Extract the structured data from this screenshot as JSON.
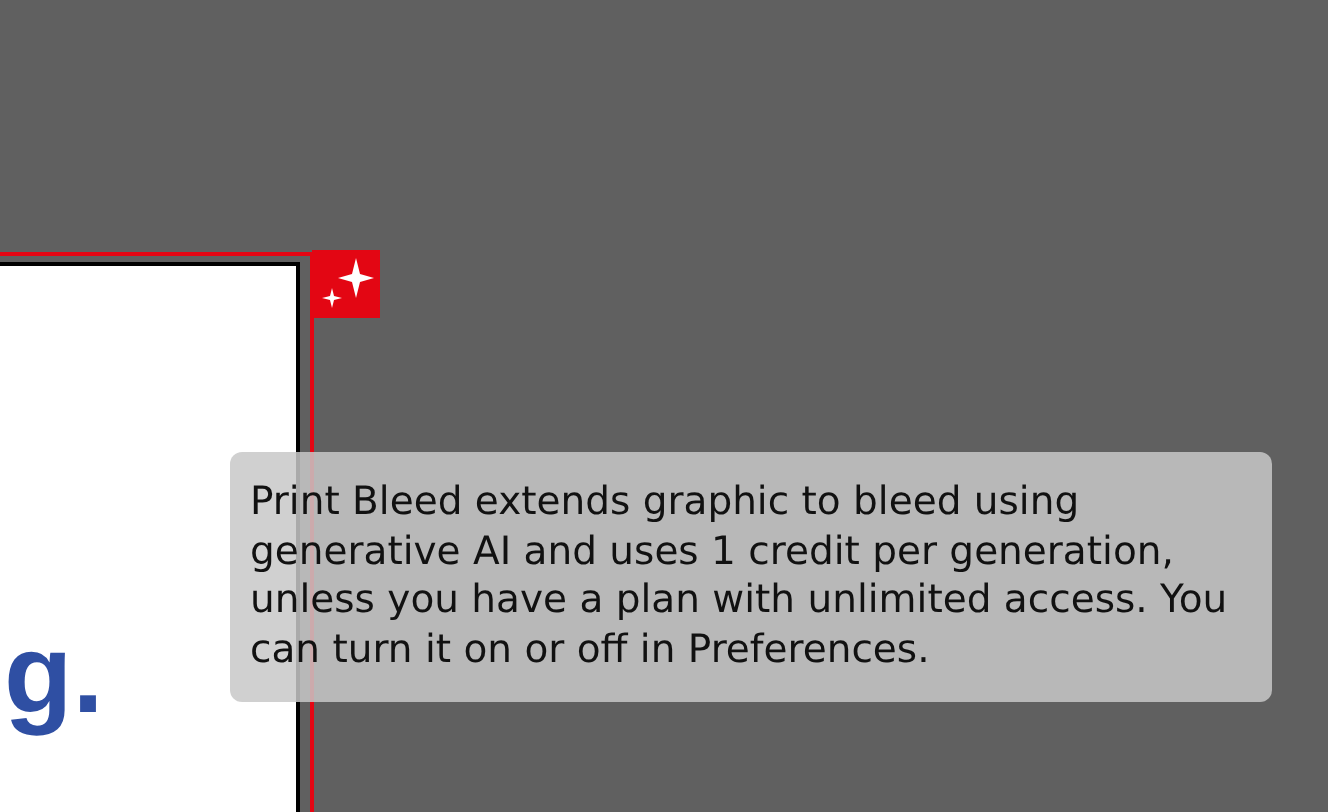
{
  "document": {
    "visible_text": "g.",
    "bleed_badge": {
      "shown": true
    }
  },
  "tooltip": {
    "text": "Print Bleed extends graphic to bleed using generative AI and uses 1 credit per generation, unless you have a plan with unlimited access. You can turn it on or off in Preferences."
  }
}
